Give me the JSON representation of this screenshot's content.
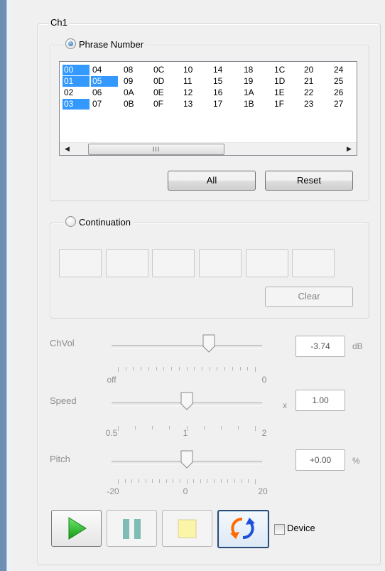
{
  "channel": {
    "title": "Ch1"
  },
  "phrase": {
    "label": "Phrase Number",
    "rows": [
      [
        {
          "t": "00",
          "sel": true
        },
        {
          "t": "04"
        },
        {
          "t": "08"
        },
        {
          "t": "0C"
        },
        {
          "t": "10"
        },
        {
          "t": "14"
        },
        {
          "t": "18"
        },
        {
          "t": "1C"
        },
        {
          "t": "20"
        },
        {
          "t": "24"
        }
      ],
      [
        {
          "t": "01",
          "sel": true
        },
        {
          "t": "05",
          "sel": true
        },
        {
          "t": "09"
        },
        {
          "t": "0D"
        },
        {
          "t": "11"
        },
        {
          "t": "15"
        },
        {
          "t": "19"
        },
        {
          "t": "1D"
        },
        {
          "t": "21"
        },
        {
          "t": "25"
        }
      ],
      [
        {
          "t": "02"
        },
        {
          "t": "06"
        },
        {
          "t": "0A"
        },
        {
          "t": "0E"
        },
        {
          "t": "12"
        },
        {
          "t": "16"
        },
        {
          "t": "1A"
        },
        {
          "t": "1E"
        },
        {
          "t": "22"
        },
        {
          "t": "26"
        }
      ],
      [
        {
          "t": "03",
          "sel": true
        },
        {
          "t": "07"
        },
        {
          "t": "0B"
        },
        {
          "t": "0F"
        },
        {
          "t": "13"
        },
        {
          "t": "17"
        },
        {
          "t": "1B"
        },
        {
          "t": "1F"
        },
        {
          "t": "23"
        },
        {
          "t": "27"
        }
      ]
    ],
    "scroll_grip": "III",
    "all_button": "All",
    "reset_button": "Reset"
  },
  "continuation": {
    "label": "Continuation",
    "clear_button": "Clear"
  },
  "chvol": {
    "label": "ChVol",
    "value": "-3.74",
    "unit": "dB",
    "tick_min": "off",
    "tick_max": "0",
    "position": 0.66
  },
  "speed": {
    "label": "Speed",
    "value": "1.00",
    "unit": "x",
    "tick_min": "0.5",
    "tick_mid": "1",
    "tick_max": "2",
    "position": 0.5
  },
  "pitch": {
    "label": "Pitch",
    "value": "+0.00",
    "unit": "%",
    "tick_min": "-20",
    "tick_mid": "0",
    "tick_max": "20",
    "position": 0.5
  },
  "transport": {
    "play_icon": "play-icon",
    "pause_icon": "pause-icon",
    "stop_icon": "stop-icon",
    "loop_icon": "loop-icon",
    "device_label": "Device"
  },
  "colors": {
    "selection": "#3399ff",
    "play": "#1fae1f",
    "pause": "#5fa8a0",
    "stop": "#fbf5a8",
    "loop_orange": "#ff6a00",
    "loop_blue": "#1e4fd8"
  }
}
